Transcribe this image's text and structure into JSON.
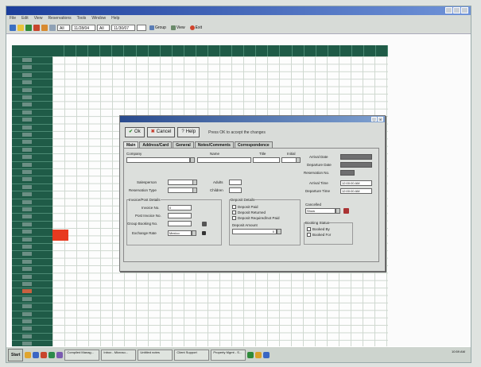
{
  "menu": {
    "items": [
      "File",
      "Edit",
      "View",
      "Reservations",
      "Tools",
      "Window",
      "Help"
    ]
  },
  "toolbar": {
    "combo1": "All",
    "combo2": "11/28/04",
    "combo3": "All",
    "combo4": "11/30/07",
    "group_label": "Group",
    "view_label": "View",
    "exit_label": "Exit"
  },
  "dialog": {
    "ok_label": "Ok",
    "cancel_label": "Cancel",
    "help_label": "Help",
    "hint": "Press OK to accept the changes",
    "tabs": [
      "Main",
      "Address/Card",
      "General",
      "Notes/Comments",
      "Correspondence"
    ],
    "labels": {
      "company": "Company",
      "name": "Name",
      "title": "Title",
      "initial": "Initial",
      "arrival_date": "Arrival Date",
      "departure_date": "Departure Date",
      "reservation_no": "Reservation No.",
      "arrival_time": "Arrival Time",
      "departure_time": "Departure Time",
      "salesperson": "Salesperson",
      "reservation_type": "Reservation Type",
      "adults": "Adults",
      "children": "Children",
      "invoice_group": "Invoice/Post Details",
      "invoice_no": "Invoice No.",
      "post_invoice_no": "Post Invoice No.",
      "group_booking_no": "Group Booking No.",
      "exchange_rate": "Exchange Rate",
      "deposit_details": "Deposit Details",
      "deposit_paid": "Deposit Paid",
      "deposit_returned": "Deposit Returned",
      "deposit_required": "Deposit Required/not Paid",
      "deposit_amount": "Deposit Amount",
      "cancelled": "Cancelled",
      "booking_status": "Booking Status",
      "booked_by": "Booked By",
      "booked_for": "Booked For"
    },
    "values": {
      "arrival_time": "12:00:00 AM",
      "departure_time": "12:00:00 AM",
      "invoice_no": "0",
      "exchange_rate": "Mexico",
      "deposit_amount": "0",
      "cancelled_value": "Show"
    }
  },
  "taskbar": {
    "start_label": "Start",
    "tasks": [
      "Compiled Manag...",
      "Inbox - Microso...",
      "Untitled notes",
      "Client Support",
      "Property Mgmt - S...",
      "Inn AMS - Inn...",
      "New Tracker R...",
      "Unified Bull...",
      "Microsft..."
    ],
    "clock": "10:59 AM"
  }
}
